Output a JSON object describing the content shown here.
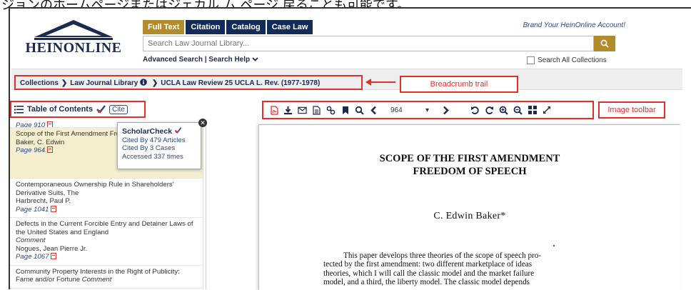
{
  "caption": "ジョンのホームページまたはジェカル ム ページ 戻ることも可能です。",
  "header": {
    "logo_text": "HEINONLINE",
    "tabs": [
      "Full Text",
      "Citation",
      "Catalog",
      "Case Law"
    ],
    "active_tab": "Full Text",
    "brand_link": "Brand Your HeinOnline Account!",
    "search_placeholder": "Search Law Journal Library...",
    "advanced_search": "Advanced Search",
    "link_sep": "|",
    "search_help": "Search Help",
    "search_all_label": "Search All Collections"
  },
  "breadcrumb": {
    "items": [
      "Collections",
      "Law Journal Library",
      "UCLA Law Review 25 UCLA L. Rev. (1977-1978)"
    ],
    "callout": "Breadcrumb trail"
  },
  "toc": {
    "title": "Table of Contents",
    "cite_label": "Cite",
    "items": [
      {
        "title": "Page 910",
        "author": "",
        "page": ""
      },
      {
        "title": "Scope of the First Amendment Freedom of Speech",
        "author": "Baker, C. Edwin",
        "page": "Page 964"
      },
      {
        "title": "Contemporaneous Ownership Rule in Shareholders' Derivative Suits, The",
        "author": "Harbrecht, Paul P.",
        "page": "Page 1041"
      },
      {
        "title": "Defects in the Current Forcible Entry and Detainer Laws of the United States and England",
        "subtitle": "Comment",
        "author": "Nogues, Jean Pierre Jr.",
        "page": "Page 1067"
      },
      {
        "title": "Community Property Interests in the Right of Publicity: Fame and/or Fortune",
        "subtitle": "Comment",
        "author": "",
        "page": ""
      }
    ]
  },
  "scholarcheck": {
    "title": "ScholarCheck",
    "cited_articles": "Cited By 479 Articles",
    "cited_cases": "Cited By 3 Cases",
    "accessed": "Accessed 337 times"
  },
  "toolbar": {
    "page_value": "964",
    "callout": "Image toolbar",
    "icons": [
      "pdf-icon",
      "download-icon",
      "email-icon",
      "text-icon",
      "link-icon",
      "bookmark-icon",
      "search-icon",
      "prev-page-icon",
      "next-page-icon",
      "rotate-left-icon",
      "rotate-right-icon",
      "zoom-in-icon",
      "zoom-out-icon",
      "thumbnails-icon",
      "fullscreen-icon"
    ]
  },
  "document": {
    "title_line1": "SCOPE OF THE FIRST AMENDMENT",
    "title_line2": "FREEDOM OF SPEECH",
    "author": "C. Edwin Baker*",
    "body_lines": [
      "This paper develops three theories of the scope of speech pro-",
      "tected by the first amendment: two different marketplace of ideas",
      "theories, which I will call the classic model and the market failure",
      "model, and a third, the liberty model.  The classic model depends"
    ]
  },
  "colors": {
    "navy": "#132b59",
    "gold": "#b38b2b",
    "annotation_red": "#e0302a"
  }
}
